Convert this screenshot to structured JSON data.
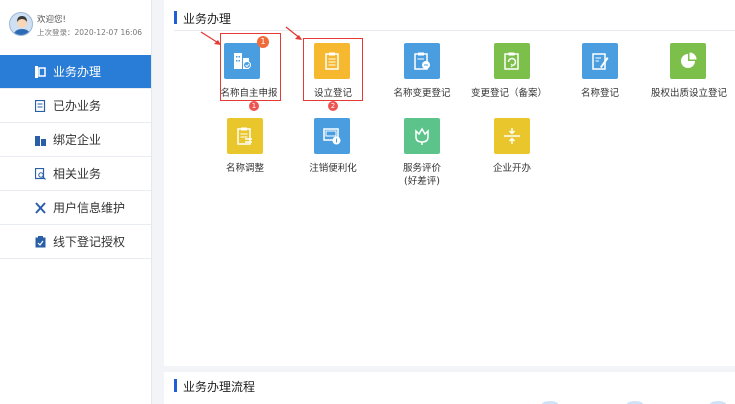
{
  "profile": {
    "welcome": "欢迎您!",
    "last_login": "上次登录：2020-12-07 16:06"
  },
  "sidebar": {
    "items": [
      {
        "label": "业务办理",
        "icon": "business-icon"
      },
      {
        "label": "已办业务",
        "icon": "done-list-icon"
      },
      {
        "label": "绑定企业",
        "icon": "building-icon"
      },
      {
        "label": "相关业务",
        "icon": "search-doc-icon"
      },
      {
        "label": "用户信息维护",
        "icon": "tools-icon"
      },
      {
        "label": "线下登记授权",
        "icon": "clipboard-icon"
      }
    ]
  },
  "main": {
    "section_title": "业务办理",
    "tiles": [
      {
        "label": "名称自主申报",
        "color": "#4a9ee0",
        "icon": "building-icon"
      },
      {
        "label": "设立登记",
        "color": "#f5b82e",
        "icon": "document-icon"
      },
      {
        "label": "名称变更登记",
        "color": "#4a9ee0",
        "icon": "clipboard-edit-icon"
      },
      {
        "label": "变更登记（备案）",
        "color": "#7cc04b",
        "icon": "clipboard-refresh-icon"
      },
      {
        "label": "名称登记",
        "color": "#4a9ee0",
        "icon": "pen-document-icon"
      },
      {
        "label": "股权出质设立登记",
        "color": "#7cc04b",
        "icon": "pie-chart-icon"
      },
      {
        "label": "名称调整",
        "color": "#e8c62c",
        "icon": "clipboard-list-icon"
      },
      {
        "label": "注销便利化",
        "color": "#4a9ee0",
        "icon": "cancel-card-icon"
      },
      {
        "label": "服务评价\n(好差评)",
        "color": "#5cc48a",
        "icon": "tulip-icon"
      },
      {
        "label": "企业开办",
        "color": "#e8c62c",
        "icon": "split-icon"
      }
    ],
    "badges": {
      "tile_badge": "1",
      "step_one": "1",
      "step_two": "2"
    }
  },
  "flow": {
    "section_title": "业务办理流程"
  },
  "colors": {
    "accent": "#2a7dd6",
    "section_bar": "#1e5fd6",
    "highlight": "#e53935"
  }
}
